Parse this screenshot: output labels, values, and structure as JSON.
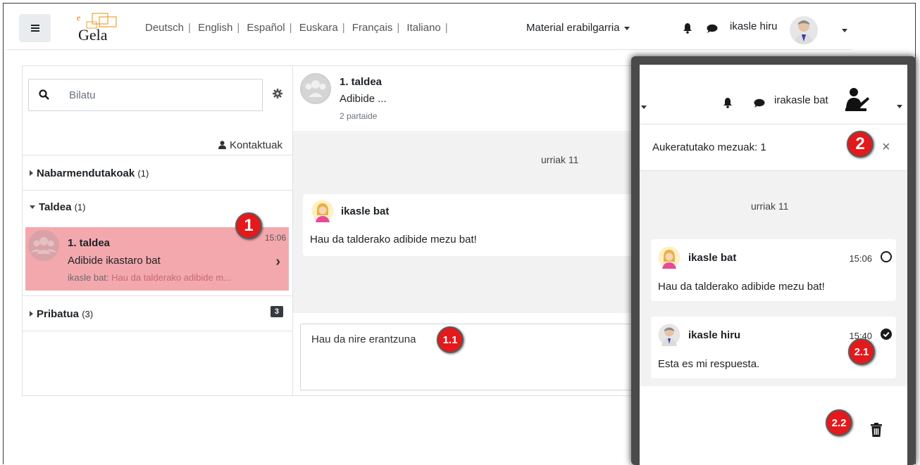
{
  "navbar": {
    "languages": [
      "Deutsch",
      "English",
      "Español",
      "Euskara",
      "Français",
      "Italiano"
    ],
    "material_label": "Material erabilgarria",
    "user_name": "ikasle hiru",
    "logo_text": "Gela",
    "logo_e": "e"
  },
  "drawer": {
    "search_placeholder": "Bilatu",
    "contacts_label": "Kontaktuak",
    "starred": {
      "label": "Nabarmendutakoak",
      "count": "(1)"
    },
    "group": {
      "label": "Taldea",
      "count": "(1)"
    },
    "private": {
      "label": "Pribatua",
      "count": "(3)",
      "unread": "3"
    },
    "conversation": {
      "name": "1. taldea",
      "time": "15:06",
      "subtitle": "Adibide ikastaro bat",
      "last_sender": "ikasle bat:",
      "last_text": "Hau da talderako adibide m..."
    }
  },
  "main": {
    "name": "1. taldea",
    "subtitle": "Adibide ...",
    "participants": "2 partaide",
    "date": "urriak 11",
    "message": {
      "sender": "ikasle bat",
      "text": "Hau da talderako adibide mezu bat!"
    },
    "composer_value": "Hau da nire erantzuna"
  },
  "overlay": {
    "user_name": "irakasle bat",
    "selected_label": "Aukeratutako mezuak: 1",
    "close": "×",
    "date": "urriak 11",
    "messages": [
      {
        "sender": "ikasle bat",
        "time": "15:06",
        "text": "Hau da talderako adibide mezu bat!",
        "selected": false
      },
      {
        "sender": "ikasle hiru",
        "time": "15:40",
        "text": "Esta es mi respuesta.",
        "selected": true
      }
    ]
  },
  "markers": {
    "m1": "1",
    "m1_1": "1.1",
    "m2": "2",
    "m2_1": "2.1",
    "m2_2": "2.2"
  },
  "colors": {
    "highlight": "#f3a8ad",
    "marker": "#e3191c"
  }
}
